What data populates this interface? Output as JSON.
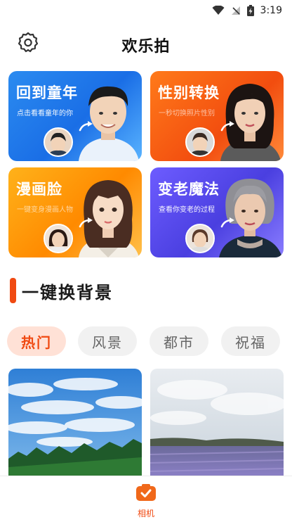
{
  "status_bar": {
    "time": "3:19"
  },
  "header": {
    "title": "欢乐拍",
    "settings_icon": "gear-icon"
  },
  "feature_cards": [
    {
      "title": "回到童年",
      "subtitle": "点击看看童年的你",
      "color": "#1a6ee6"
    },
    {
      "title": "性别转换",
      "subtitle": "一秒切换照片性别",
      "color": "#f24d0f"
    },
    {
      "title": "漫画脸",
      "subtitle": "一键变身漫画人物",
      "color": "#ff8a00"
    },
    {
      "title": "变老魔法",
      "subtitle": "查看你变老的过程",
      "color": "#4a3fe0"
    }
  ],
  "section": {
    "title": "一键换背景",
    "accent": "#f04a12"
  },
  "categories": [
    {
      "label": "热门",
      "active": true
    },
    {
      "label": "风景",
      "active": false
    },
    {
      "label": "都市",
      "active": false
    },
    {
      "label": "祝福",
      "active": false
    }
  ],
  "bottom_nav": {
    "camera_label": "相机",
    "icon": "camera-icon"
  }
}
